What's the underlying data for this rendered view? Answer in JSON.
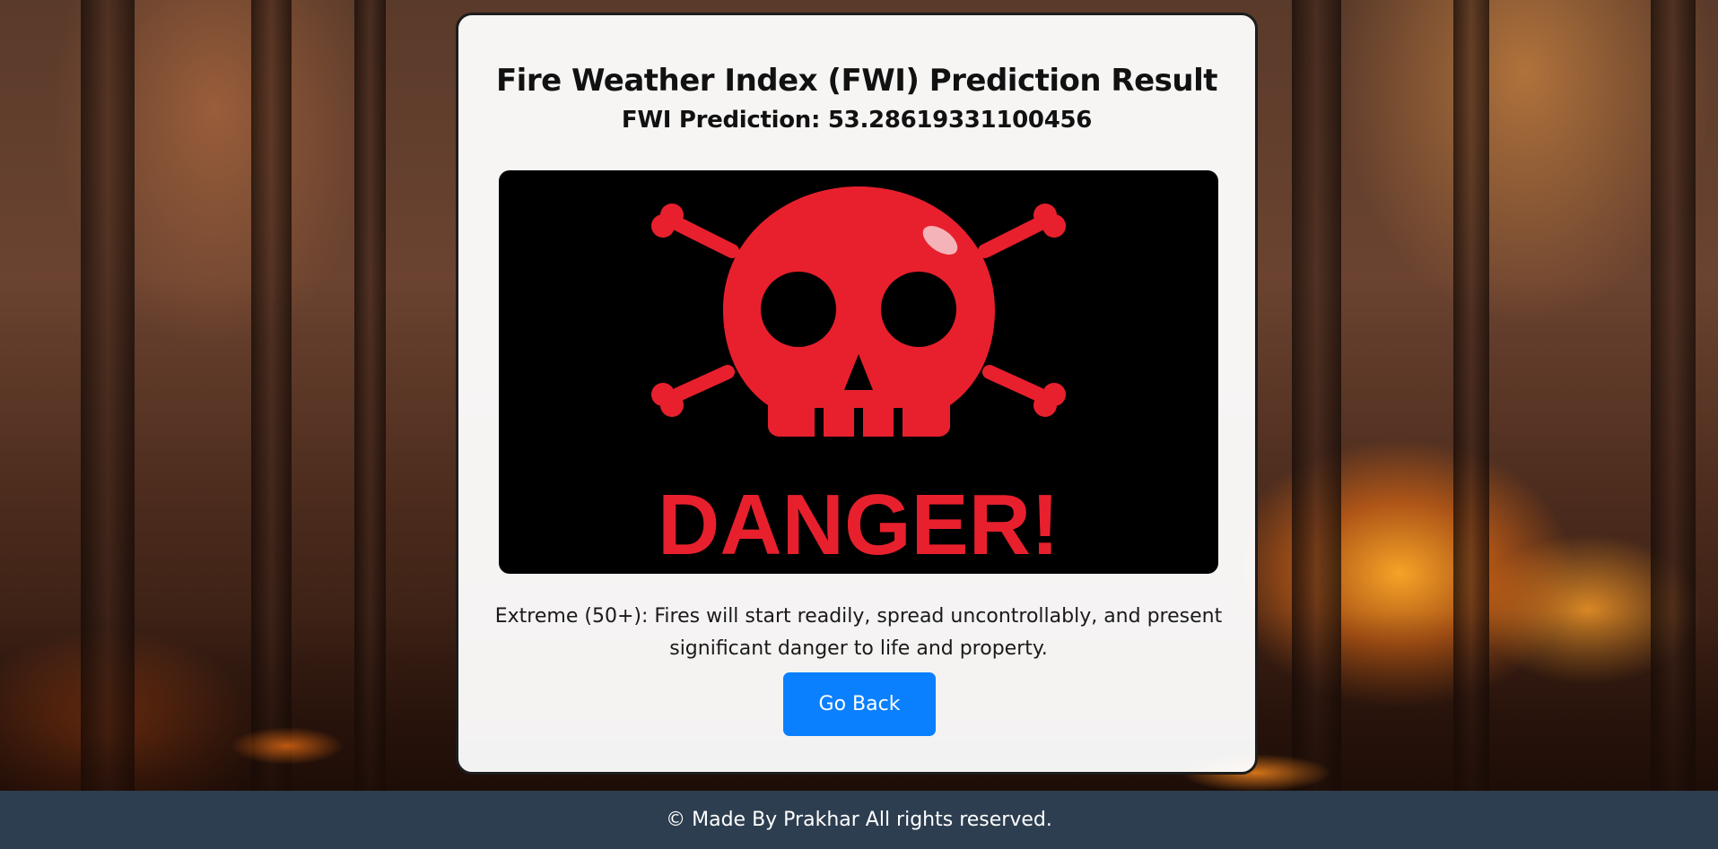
{
  "result": {
    "title": "Fire Weather Index (FWI) Prediction Result",
    "prediction_text": "FWI Prediction: 53.28619331100456",
    "danger_image": {
      "icon": "skull-crossbones-icon",
      "text": "DANGER!"
    },
    "description": "Extreme (50+): Fires will start readily, spread uncontrollably, and present significant danger to life and property.",
    "go_back_label": "Go Back"
  },
  "footer": {
    "text": "© Made By Prakhar All rights reserved."
  },
  "colors": {
    "button": "#0a80ff",
    "footer": "#2d3e50",
    "danger_red": "#e8202d"
  }
}
